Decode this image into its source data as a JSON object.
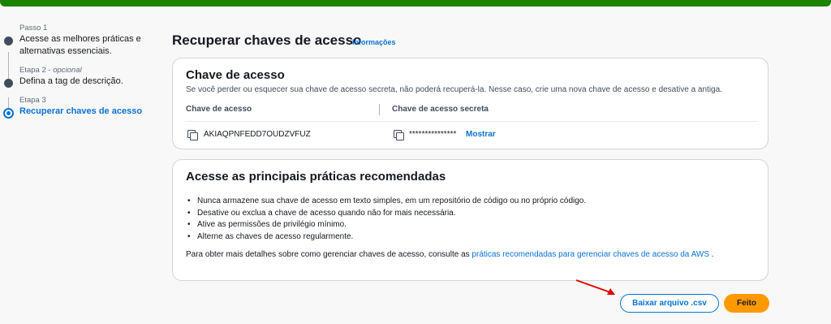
{
  "steps": [
    {
      "label": "Passo 1",
      "optional": "",
      "title": "Acesse as melhores práticas e alternativas essenciais.",
      "active": false
    },
    {
      "label": "Etapa 2 - ",
      "optional": "opcional",
      "title": "Defina a tag de descrição.",
      "active": false
    },
    {
      "label": "Etapa 3",
      "optional": "",
      "title": "Recuperar chaves de acesso",
      "active": true
    }
  ],
  "page": {
    "title": "Recuperar chaves de acesso",
    "info_link": "Informações"
  },
  "access_key_card": {
    "title": "Chave de acesso",
    "description": "Se você perder ou esquecer sua chave de acesso secreta, não poderá recuperá-la. Nesse caso, crie uma nova chave de acesso e desative a antiga.",
    "col_access_key": "Chave de acesso",
    "col_secret_key": "Chave de acesso secreta",
    "access_key_value": "AKIAQPNFEDD7OUDZVFUZ",
    "secret_key_masked": "***************",
    "show_label": "Mostrar"
  },
  "best_practices_card": {
    "title": "Acesse as principais práticas recomendadas",
    "bullets": [
      "Nunca armazene sua chave de acesso em texto simples, em um repositório de código ou no próprio código.",
      "Desative ou exclua a chave de acesso quando não for mais necessária.",
      "Ative as permissões de privilégio mínimo.",
      "Alterne as chaves de acesso regularmente."
    ],
    "more_prefix": "Para obter mais detalhes sobre como gerenciar chaves de acesso, consulte as ",
    "more_link": "práticas recomendadas para gerenciar chaves de acesso da AWS",
    "more_suffix": " ."
  },
  "actions": {
    "download_csv": "Baixar arquivo .csv",
    "done": "Feito"
  },
  "colors": {
    "accent": "#0972d3",
    "primary_button": "#ff9900",
    "topbar": "#1d8102",
    "annotation_arrow": "#e00000"
  }
}
